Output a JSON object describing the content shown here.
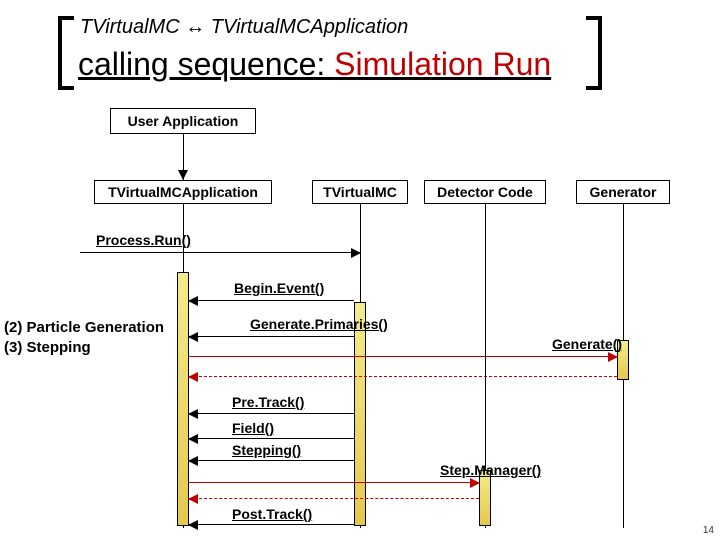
{
  "title": {
    "small": "TVirtualMC ↔ TVirtualMCApplication",
    "big_black": "calling sequence: ",
    "big_red": "Simulation Run"
  },
  "lifelines": {
    "user": "User Application",
    "app": "TVirtualMCApplication",
    "vmc": "TVirtualMC",
    "det": "Detector Code",
    "gen": "Generator"
  },
  "messages": {
    "processRun": "Process.Run()",
    "beginEvent": "Begin.Event()",
    "generatePrimaries": "Generate.Primaries()",
    "generate": "Generate()",
    "preTrack": "Pre.Track()",
    "field": "Field()",
    "stepping": "Stepping()",
    "stepManager": "Step.Manager()",
    "postTrack": "Post.Track()"
  },
  "notes": {
    "line1": "(2) Particle Generation",
    "line2": "(3) Stepping"
  },
  "page_number": "14"
}
